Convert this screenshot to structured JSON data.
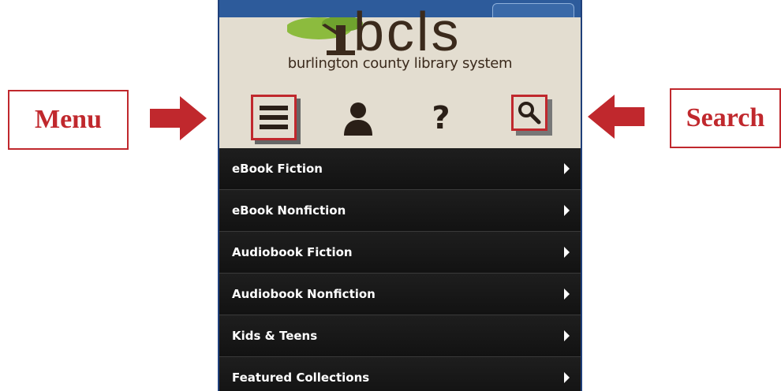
{
  "callouts": {
    "menu_label": "Menu",
    "search_label": "Search"
  },
  "header": {
    "logo_text": "bcls",
    "logo_subtitle": "burlington county library system"
  },
  "toolbar": {
    "icons": [
      "menu-icon",
      "user-icon",
      "help-icon",
      "search-icon"
    ],
    "help_glyph": "?"
  },
  "menu": {
    "items": [
      {
        "label": "eBook Fiction"
      },
      {
        "label": "eBook Nonfiction"
      },
      {
        "label": "Audiobook Fiction"
      },
      {
        "label": "Audiobook Nonfiction"
      },
      {
        "label": "Kids & Teens"
      },
      {
        "label": "Featured Collections"
      }
    ]
  },
  "colors": {
    "accent_red": "#c0282d",
    "header_bg": "#e3ddd0",
    "menu_bg": "#151515",
    "top_bar": "#2d5b9b"
  }
}
